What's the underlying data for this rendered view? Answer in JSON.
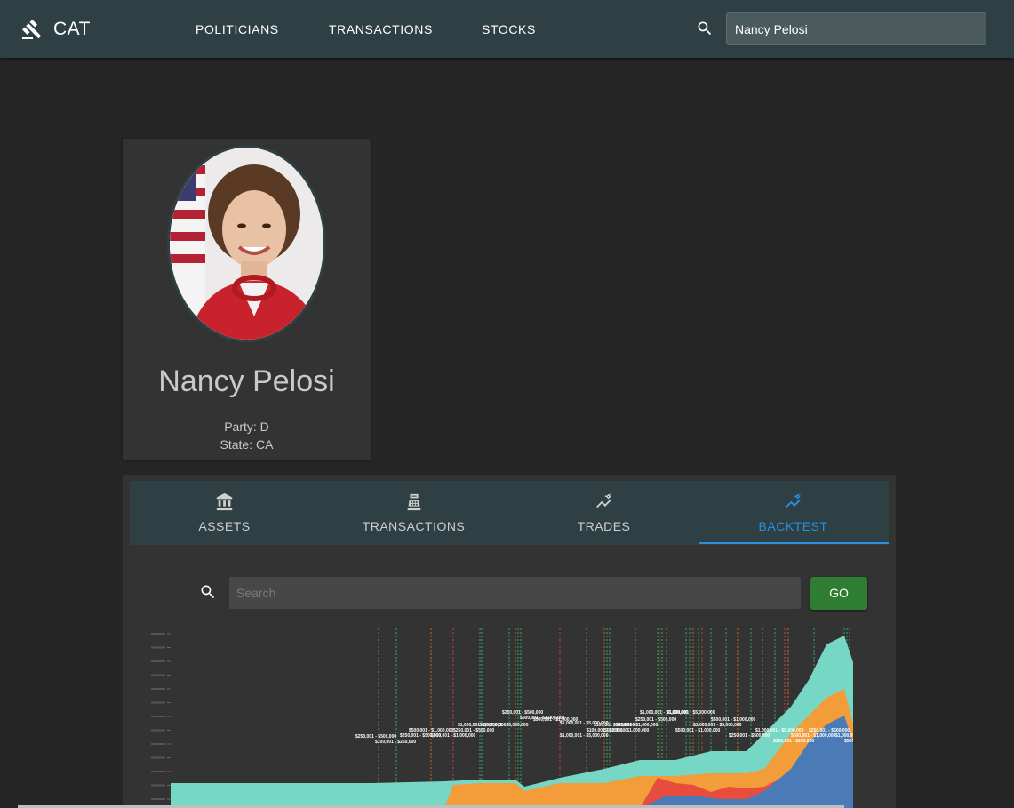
{
  "app": {
    "brand": "CAT",
    "brand_icon": "gavel-icon"
  },
  "nav": [
    {
      "label": "POLITICIANS"
    },
    {
      "label": "TRANSACTIONS"
    },
    {
      "label": "STOCKS"
    }
  ],
  "top_search": {
    "value": "Nancy Pelosi",
    "icon": "search-icon"
  },
  "profile": {
    "name": "Nancy Pelosi",
    "party": "Party: D",
    "state": "State: CA"
  },
  "tabs": [
    {
      "label": "ASSETS",
      "icon": "bank-icon"
    },
    {
      "label": "TRANSACTIONS",
      "icon": "cash-register-icon"
    },
    {
      "label": "TRADES",
      "icon": "trending-icon"
    },
    {
      "label": "BACKTEST",
      "icon": "trending-icon",
      "active": true
    }
  ],
  "backtest": {
    "search_placeholder": "Search",
    "go_label": "GO"
  },
  "colors": {
    "accent": "#2b8fe0",
    "go_button": "#2e7d32",
    "area_teal": "#76d7c4",
    "area_orange": "#f39c3a",
    "area_red": "#e74c3c",
    "area_blue": "#4a7bb7",
    "buy_line": "#2ecc71",
    "sell_line": "#e74c3c",
    "exchange_line": "#e67e22"
  },
  "chart_data": {
    "type": "area",
    "labels": [
      "$250,001 - $500,000",
      "$100,001 - $250,000",
      "$500,001 - $1,000,000",
      "$1,000,001 - $5,000,000",
      "$250,001 - $500,000",
      "$500,001 - $1,000,000",
      "$1,000,001 - $5,000,000",
      "$100,001 - $250,000",
      "$500,001 - $1,000,000",
      "$1,000,001 - $5,000,000",
      "$250,001 - $500,000",
      "$500,001 - $1,000,000",
      "$250,001 - $500,000",
      "$1,000,001 - $5,000,000",
      "$500,001 - $1,000,000",
      "$1,000,001 - $5,000,000",
      "$100,001 - $250,000",
      "$500,001 - $1,000,000",
      "$250,001 - $500,000",
      "$1,000,001 - $5,000,000",
      "$500,001 - $1,000,000",
      "$1,000,001 - $5,000,000",
      "$500,001 - $1,000,000",
      "$250,001 - $500,000",
      "$1,000,001 - $5,000,000",
      "$100,001 - $250,000",
      "$500,001 - $1,000,000",
      "$250,001 - $500,000",
      "$1,000,001 - $5,000,000",
      "$500,001 - $1,000,000"
    ]
  }
}
